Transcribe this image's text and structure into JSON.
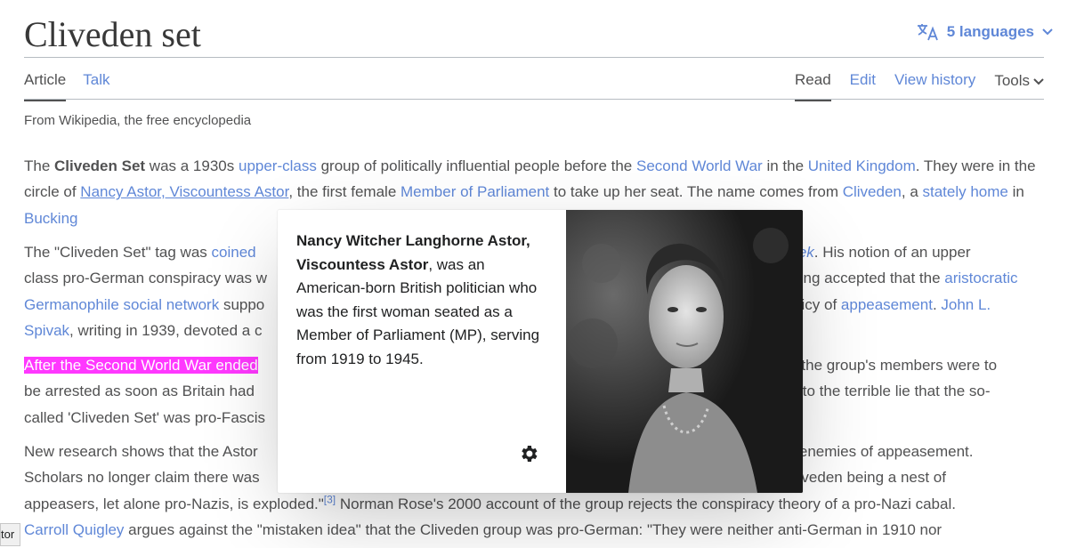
{
  "page": {
    "title": "Cliveden set",
    "languages": "5 languages",
    "tagline": "From Wikipedia, the free encyclopedia"
  },
  "tabs": {
    "article": "Article",
    "talk": "Talk",
    "read": "Read",
    "edit": "Edit",
    "history": "View history",
    "tools": "Tools"
  },
  "paragraphs": {
    "p1": {
      "t1": "The ",
      "b1": "Cliveden Set",
      "t2": " was a 1930s ",
      "l1": "upper-class",
      "t3": " group of politically influential people before the ",
      "l2": "Second World War",
      "t4": " in the ",
      "l3": "United Kingdom",
      "t5": ". They were in the circle of ",
      "l4": "Nancy Astor, Viscountess Astor",
      "t6": ", the first female ",
      "l5": "Member of Parliament",
      "t7": " to take up her seat. The name comes from ",
      "l6": "Cliveden",
      "t8": ", a ",
      "l7": "stately home",
      "t9": " in ",
      "l8": "Bucking"
    },
    "p2": {
      "t1": "The \"Cliveden Set\" tag was ",
      "l1": "coined",
      "l2": "Week",
      "t2": ". His notion of an upper",
      "t3": "class pro-German conspiracy was w",
      "t4": "ong accepted that the ",
      "l3": "aristocratic",
      "l4": "Germanophile social network",
      "t5": " suppo",
      "t6": "olicy of ",
      "l5": "appeasement",
      "t7": ". ",
      "l6": "John L.",
      "l7": "Spivak",
      "t8": ", writing in 1939, devoted a c"
    },
    "p3": {
      "h1": "After the Second World War ended",
      "t1": "all the group's members were to",
      "t2": "be arrested as soon as Britain had",
      "t3": "er to the terrible lie that the so-",
      "t4": "called 'Cliveden Set' was pro-Fascis"
    },
    "p4": {
      "t1": "New research shows that the Astor",
      "t2": "d enemies of appeasement.",
      "t3": "Scholars no longer claim there was",
      "t4": "Cliveden being a nest of",
      "t5": "appeasers, let alone pro-Nazis, is exploded.\"",
      "s1": "[3]",
      "t6": " Norman Rose's 2000 account of the group rejects the conspiracy theory of a pro-Nazi cabal.",
      "l1": "Carroll Quigley",
      "t7": " argues against the \"mistaken idea\" that the Cliveden group was pro-German: \"They were neither anti-German in 1910 nor"
    }
  },
  "popup": {
    "bold": "Nancy Witcher Langhorne Astor, Viscountess Astor",
    "rest": ", was an American-born British politician who was the first woman seated as a Member of Parliament (MP), serving from 1919 to 1945."
  },
  "status_tip": "tor",
  "colors": {
    "link": "#3366cc",
    "highlight": "#ff00ff",
    "text": "#202122",
    "rule": "#a2a9b1"
  },
  "icons": {
    "language": "translate-icon",
    "chevron": "chevron-down-icon",
    "settings": "gear-icon"
  }
}
